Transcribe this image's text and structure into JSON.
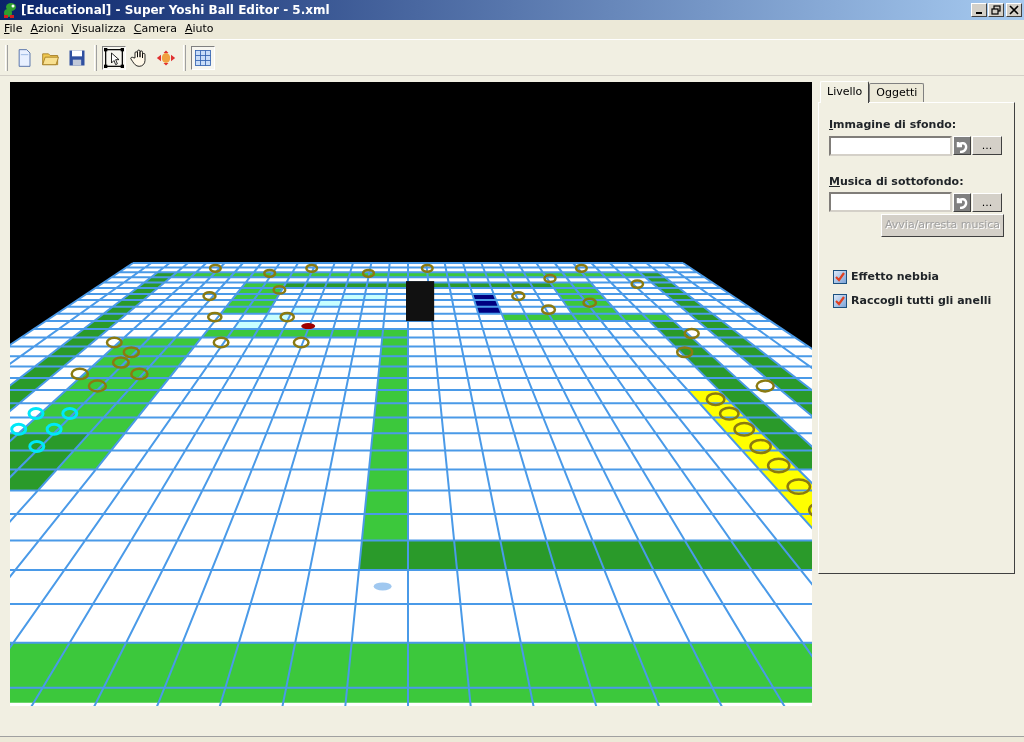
{
  "window": {
    "title": "[Educational] - Super Yoshi Ball Editor - 5.xml"
  },
  "menu": [
    "File",
    "Azioni",
    "Visualizza",
    "Camera",
    "Aiuto"
  ],
  "toolbar": [
    {
      "kind": "new",
      "selected": false
    },
    {
      "kind": "open",
      "selected": false
    },
    {
      "kind": "save",
      "selected": false
    },
    {
      "kind": "sep"
    },
    {
      "kind": "select",
      "selected": true
    },
    {
      "kind": "pan",
      "selected": false
    },
    {
      "kind": "orbit",
      "selected": false
    },
    {
      "kind": "sep"
    },
    {
      "kind": "grid",
      "selected": true
    }
  ],
  "panel": {
    "tabs": [
      {
        "label": "Livello",
        "selected": true
      },
      {
        "label": "Oggetti",
        "selected": false
      }
    ],
    "fields": [
      {
        "label": "Immagine di sfondo:",
        "browse": "..."
      },
      {
        "label": "Musica di sottofondo:",
        "browse": "..."
      }
    ],
    "music_button": {
      "label": "Avvia/arresta musica",
      "disabled": true
    },
    "checkboxes": [
      {
        "label": "Effetto nebbia",
        "checked": true
      },
      {
        "label": "Raccogli tutti gli anelli",
        "checked": true
      }
    ]
  }
}
